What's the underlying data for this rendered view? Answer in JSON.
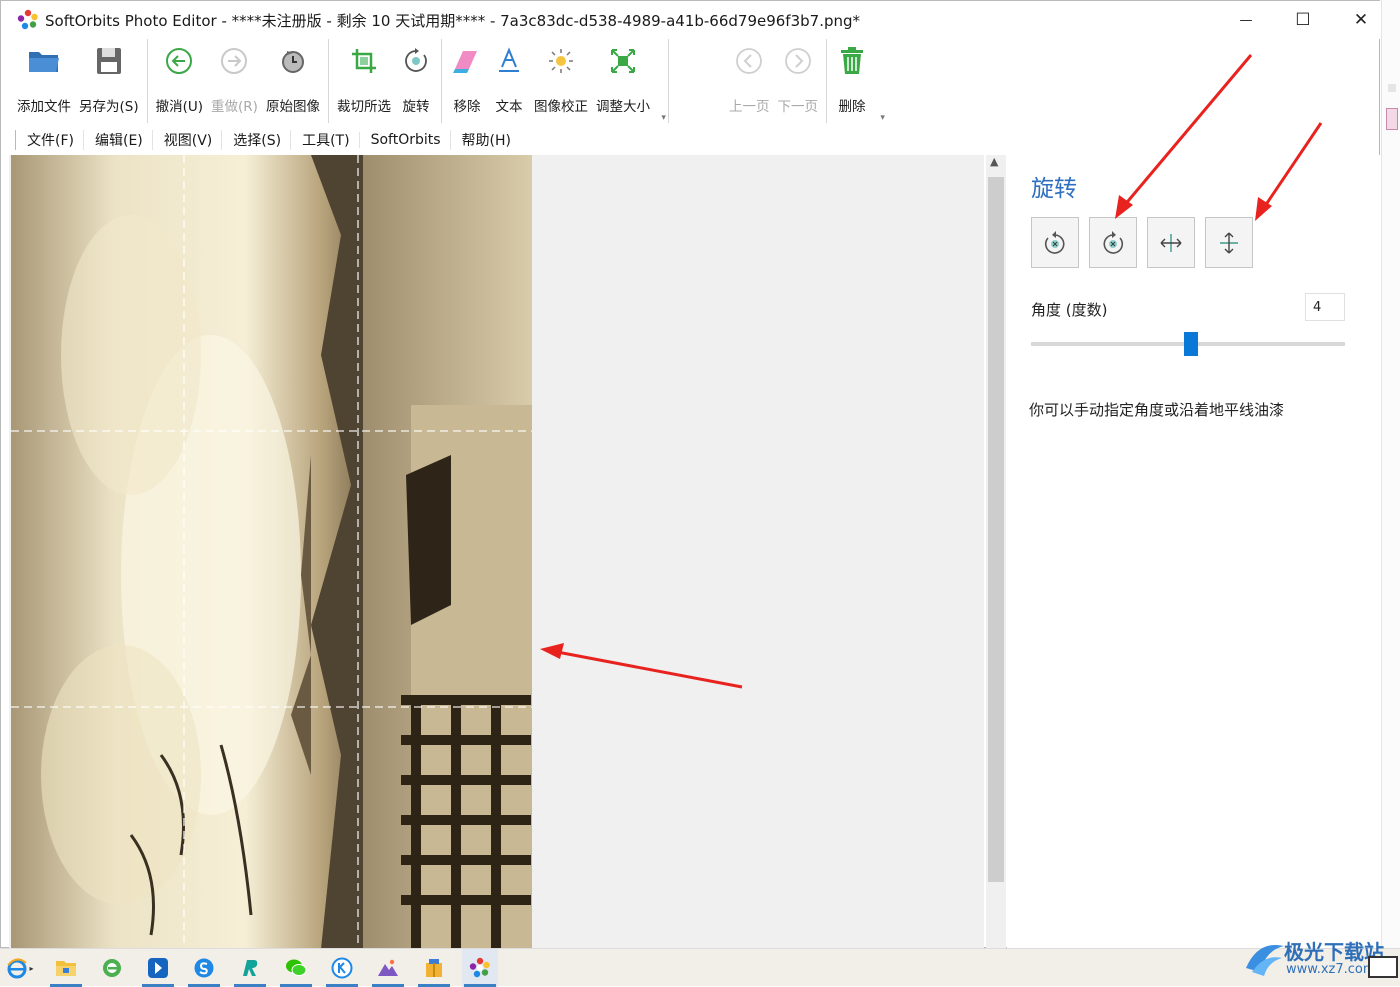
{
  "window": {
    "title": "SoftOrbits Photo Editor - ****未注册版 - 剩余 10 天试用期**** - 7a3c83dc-d538-4989-a41b-66d79e96f3b7.png*",
    "minimize": "—",
    "maximize": "☐",
    "close": "✕"
  },
  "toolbar": {
    "add_file": "添加文件",
    "save_as": "另存为(S)",
    "undo": "撤消(U)",
    "redo": "重做(R)",
    "original": "原始图像",
    "crop": "裁切所选",
    "rotate": "旋转",
    "remove": "移除",
    "text": "文本",
    "correction": "图像校正",
    "resize": "调整大小",
    "prev_page": "上一页",
    "next_page": "下一页",
    "delete": "删除"
  },
  "menu": {
    "file": "文件(F)",
    "edit": "编辑(E)",
    "view": "视图(V)",
    "select": "选择(S)",
    "tools": "工具(T)",
    "softorbits": "SoftOrbits",
    "help": "帮助(H)"
  },
  "panel": {
    "title": "旋转",
    "angle_label": "角度 (度数)",
    "angle_value": "4",
    "angle_min": -180,
    "angle_max": 180,
    "hint": "你可以手动指定角度或沿着地平线油漆"
  },
  "icons": {
    "rotate_left": "rotate-left-icon",
    "rotate_right": "rotate-right-icon",
    "flip_horizontal": "flip-horizontal-icon",
    "flip_vertical": "flip-vertical-icon"
  },
  "colors": {
    "accent": "#2e6fc0",
    "slider": "#0a78d7",
    "annotation_arrow": "#e8231f",
    "toolbar_icon_green": "#39a845"
  },
  "watermark": {
    "brand": "极光下载站",
    "url": "www.xz7.com"
  }
}
